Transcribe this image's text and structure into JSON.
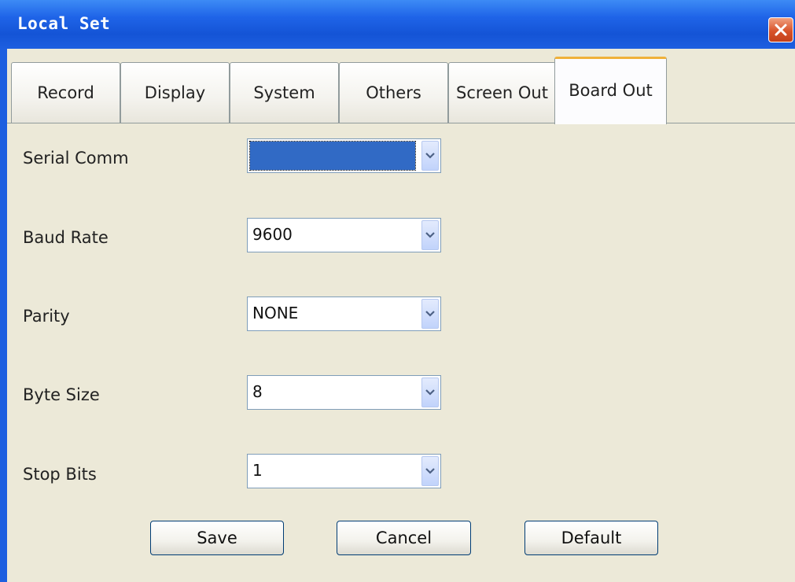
{
  "window": {
    "title": "Local Set"
  },
  "tabs": [
    {
      "label": "Record",
      "active": false
    },
    {
      "label": "Display",
      "active": false
    },
    {
      "label": "System",
      "active": false
    },
    {
      "label": "Others",
      "active": false
    },
    {
      "label": "Screen Out",
      "active": false
    },
    {
      "label": "Board Out",
      "active": true
    }
  ],
  "form": {
    "serial_comm": {
      "label": "Serial Comm",
      "value": ""
    },
    "baud_rate": {
      "label": "Baud Rate",
      "value": "9600"
    },
    "parity": {
      "label": "Parity",
      "value": "NONE"
    },
    "byte_size": {
      "label": "Byte Size",
      "value": "8"
    },
    "stop_bits": {
      "label": "Stop Bits",
      "value": "1"
    }
  },
  "buttons": {
    "save": "Save",
    "cancel": "Cancel",
    "default": "Default"
  },
  "colors": {
    "title_bar": "#1d5fe0",
    "active_tab_accent": "#f0b13a",
    "selection": "#316ac5",
    "client_bg": "#ece9d8"
  }
}
